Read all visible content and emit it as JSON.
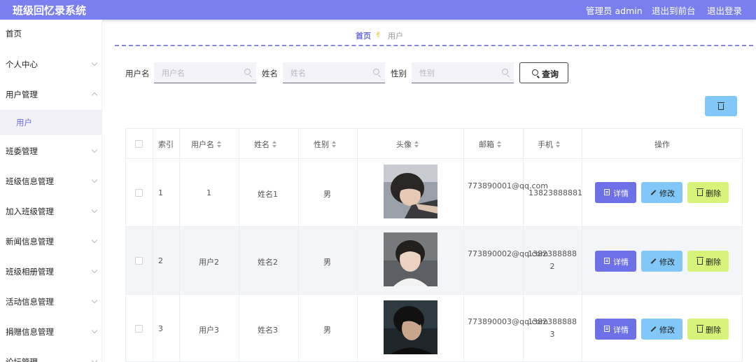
{
  "app": {
    "title": "班级回忆录系统",
    "admin_label": "管理员 admin",
    "front_label": "退出到前台",
    "logout_label": "退出登录"
  },
  "sidebar": {
    "items": [
      {
        "label": "首页"
      },
      {
        "label": "个人中心"
      },
      {
        "label": "用户管理"
      },
      {
        "label": "用户"
      },
      {
        "label": "班委管理"
      },
      {
        "label": "班级信息管理"
      },
      {
        "label": "加入班级管理"
      },
      {
        "label": "新闻信息管理"
      },
      {
        "label": "班级相册管理"
      },
      {
        "label": "活动信息管理"
      },
      {
        "label": "捐赠信息管理"
      },
      {
        "label": "论坛管理"
      }
    ]
  },
  "breadcrumb": {
    "home": "首页",
    "sep": "✌",
    "current": "用户"
  },
  "filters": {
    "username_label": "用户名",
    "username_placeholder": "用户名",
    "name_label": "姓名",
    "name_placeholder": "姓名",
    "gender_label": "性别",
    "gender_placeholder": "性别",
    "query_label": "查询"
  },
  "table": {
    "headers": [
      "索引",
      "用户名",
      "姓名",
      "性别",
      "头像",
      "邮箱",
      "手机",
      "操作"
    ],
    "rows": [
      {
        "index": "1",
        "username": "1",
        "name": "姓名1",
        "gender": "男",
        "email": "773890001@qq.com",
        "phone": "13823888881"
      },
      {
        "index": "2",
        "username": "用户2",
        "name": "姓名2",
        "gender": "男",
        "email": "773890002@qq.com",
        "phone": "13823888882"
      },
      {
        "index": "3",
        "username": "用户3",
        "name": "姓名3",
        "gender": "男",
        "email": "773890003@qq.com",
        "phone": "13823888883"
      }
    ],
    "actions": {
      "detail": "详情",
      "edit": "修改",
      "delete": "删除"
    }
  },
  "colors": {
    "topbar": "#7a7ff0",
    "detail_button": "#6d70e6",
    "edit_button": "#81c8f8",
    "delete_button": "#d7f37a"
  }
}
